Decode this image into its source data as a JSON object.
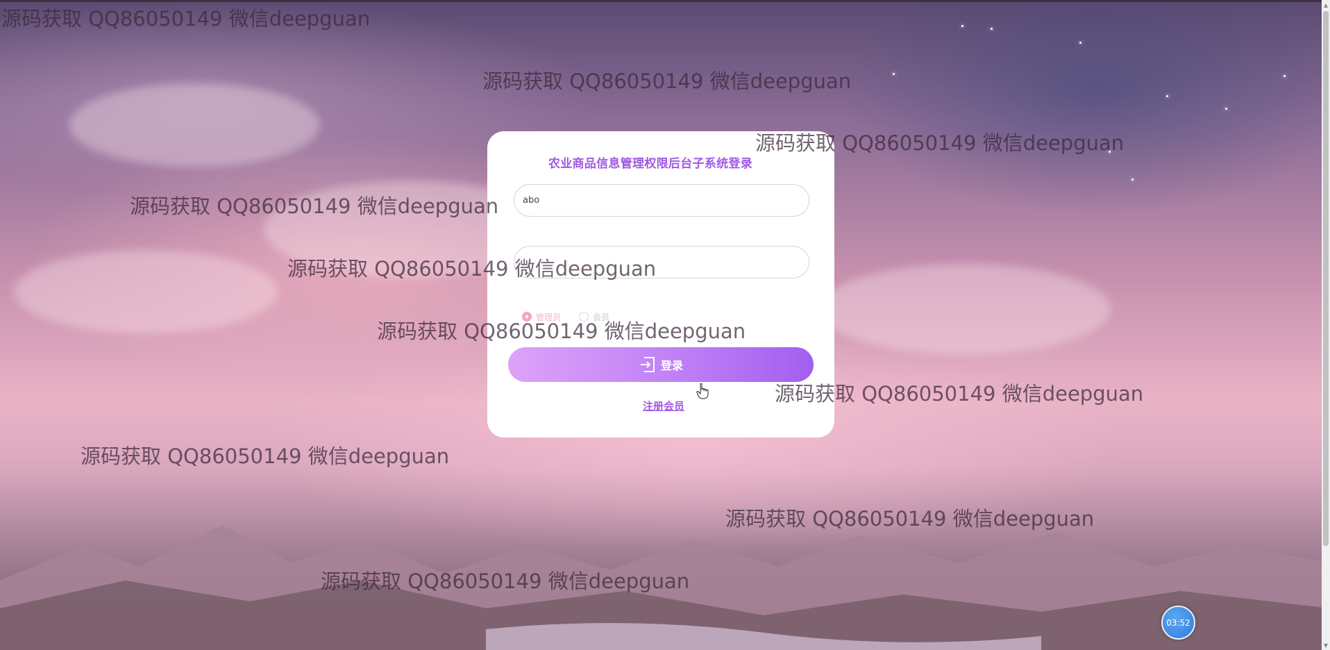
{
  "login": {
    "title": "农业商品信息管理权限后台子系统登录",
    "username_value": "abo",
    "password_value": "",
    "roles": [
      {
        "label": "管理员",
        "checked": true
      },
      {
        "label": "会员",
        "checked": false
      }
    ],
    "login_button_label": "登录",
    "login_icon": "login-enter-icon",
    "register_link_label": "注册会员",
    "accent_color": "#a158e4"
  },
  "watermark": {
    "text": "源码获取 QQ86050149 微信deepguan"
  },
  "clock_badge": {
    "time": "03:52"
  },
  "colors": {
    "button_gradient_start": "#dda3f9",
    "button_gradient_end": "#a25ff0"
  }
}
